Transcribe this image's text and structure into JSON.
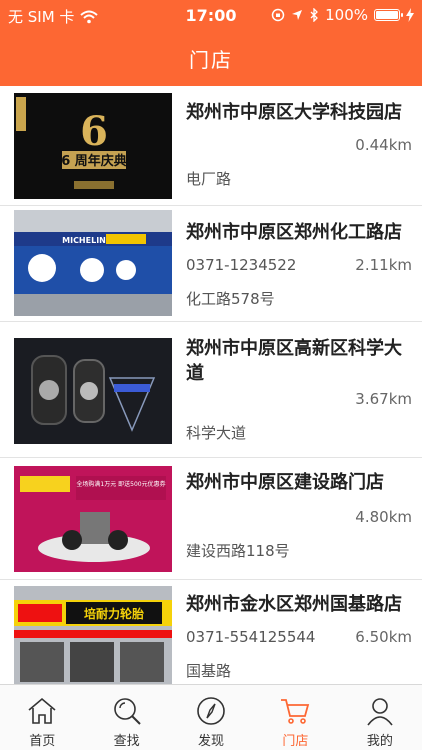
{
  "status": {
    "carrier": "无 SIM 卡",
    "time": "17:00",
    "battery": "100%"
  },
  "nav": {
    "title": "门店"
  },
  "stores": [
    {
      "name": "郑州市中原区大学科技园店",
      "phone": "",
      "distance": "0.44km",
      "address": "电厂路",
      "thumb_text": "6 周年庆典"
    },
    {
      "name": "郑州市中原区郑州化工路店",
      "phone": "0371-1234522",
      "distance": "2.11km",
      "address": "化工路578号",
      "thumb_text": "MICHELIN"
    },
    {
      "name": "郑州市中原区高新区科学大道",
      "phone": "",
      "distance": "3.67km",
      "address": "科学大道",
      "thumb_text": "tire"
    },
    {
      "name": "郑州市中原区建设路门店",
      "phone": "",
      "distance": "4.80km",
      "address": "建设西路118号",
      "thumb_text": "全场购满1万元 即送500元优惠券"
    },
    {
      "name": "郑州市金水区郑州国基路店",
      "phone": "0371-554125544",
      "distance": "6.50km",
      "address": "国基路",
      "thumb_text": "培耐力轮胎"
    }
  ],
  "tabs": [
    {
      "label": "首页",
      "icon": "home-icon",
      "active": false
    },
    {
      "label": "查找",
      "icon": "search-icon",
      "active": false
    },
    {
      "label": "发现",
      "icon": "compass-icon",
      "active": false
    },
    {
      "label": "门店",
      "icon": "cart-icon",
      "active": true
    },
    {
      "label": "我的",
      "icon": "person-icon",
      "active": false
    }
  ],
  "colors": {
    "accent": "#fd6733",
    "tab_inactive": "#333333"
  }
}
